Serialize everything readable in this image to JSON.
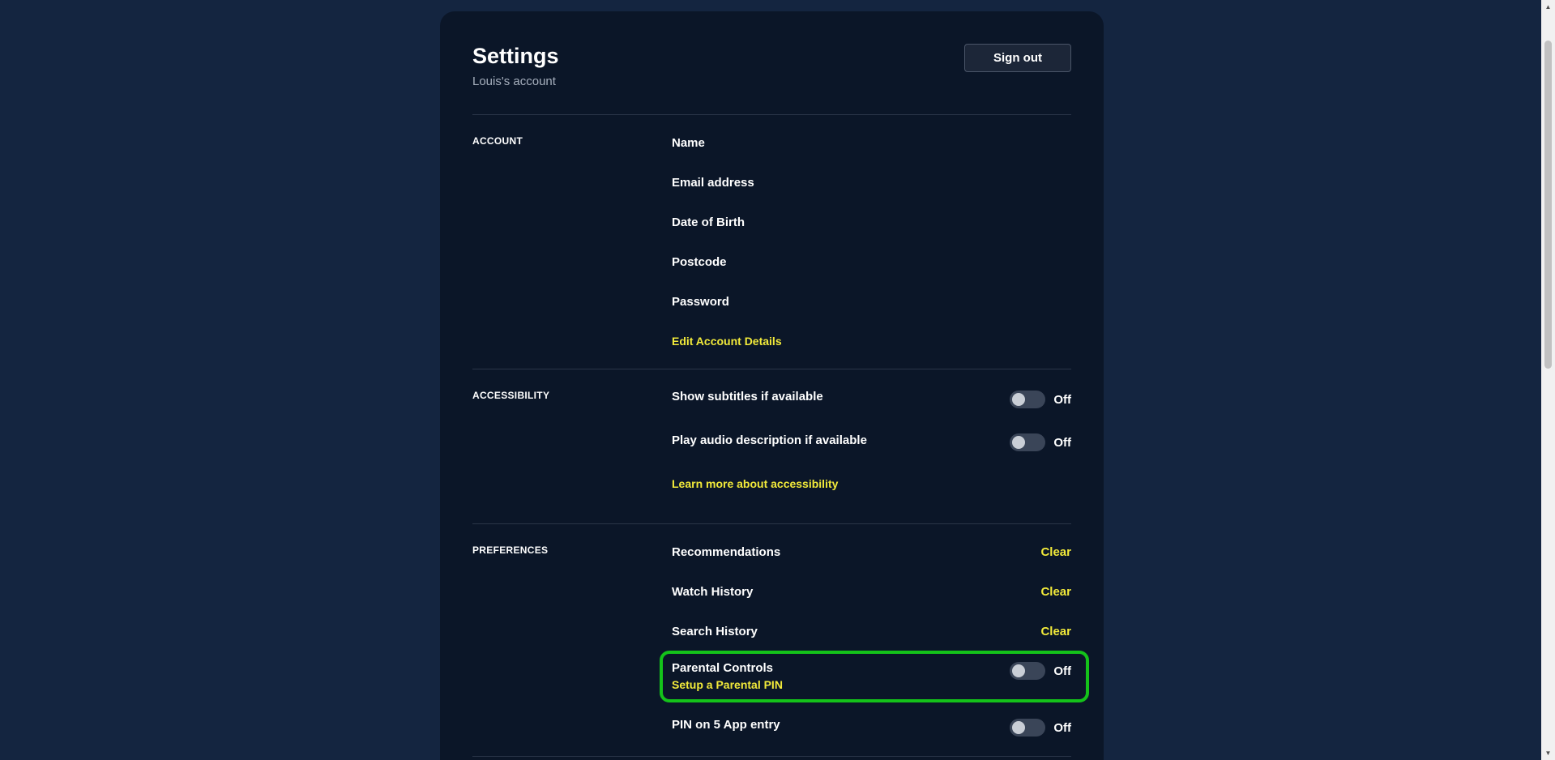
{
  "header": {
    "title": "Settings",
    "subtitle": "Louis's account",
    "sign_out_label": "Sign out"
  },
  "account": {
    "section_label": "ACCOUNT",
    "rows": [
      "Name",
      "Email address",
      "Date of Birth",
      "Postcode",
      "Password"
    ],
    "edit_link": "Edit Account Details"
  },
  "accessibility": {
    "section_label": "ACCESSIBILITY",
    "subtitles": {
      "label": "Show subtitles if available",
      "state": "Off"
    },
    "audio_description": {
      "label": "Play audio description if available",
      "state": "Off"
    },
    "learn_more_link": "Learn more about accessibility"
  },
  "preferences": {
    "section_label": "PREFERENCES",
    "clear_label": "Clear",
    "recommendations": "Recommendations",
    "watch_history": "Watch History",
    "search_history": "Search History",
    "parental_controls": {
      "label": "Parental Controls",
      "link": "Setup a Parental PIN",
      "state": "Off"
    },
    "pin_app_entry": {
      "label": "PIN on 5 App entry",
      "state": "Off"
    }
  },
  "colors": {
    "page_background": "#142540",
    "card_background": "#0b1628",
    "link": "#f2ea3a",
    "highlight": "#14c21a"
  },
  "icons": {
    "scroll_up": "scroll-up-arrow-icon",
    "scroll_down": "scroll-down-arrow-icon"
  }
}
